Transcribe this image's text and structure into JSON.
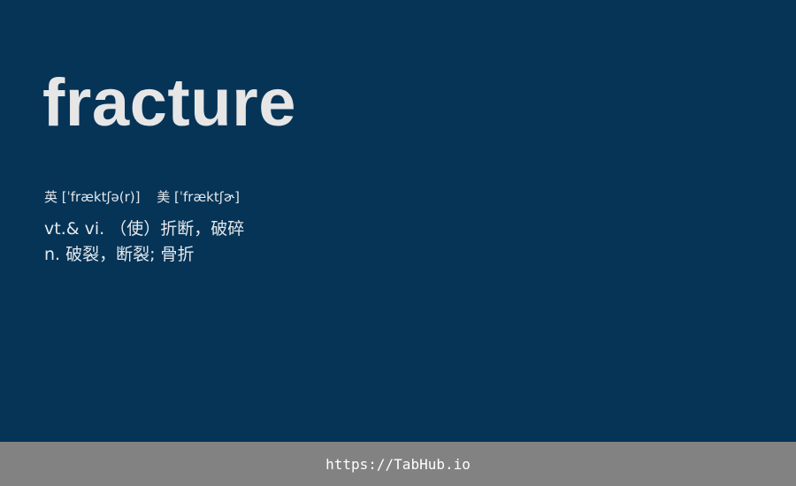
{
  "entry": {
    "word": "fracture",
    "phonetic_uk": "英 [ˈfræktʃə(r)]",
    "phonetic_us": "美 [ˈfræktʃɚ]",
    "definitions": [
      "vt.& vi. （使）折断，破碎",
      "n. 破裂，断裂; 骨折"
    ]
  },
  "footer": {
    "link_text": "https://TabHub.io"
  },
  "colors": {
    "background": "#053457",
    "word": "#e6e6e6",
    "footer_bar": "#828282",
    "footer_text": "#ffffff"
  }
}
